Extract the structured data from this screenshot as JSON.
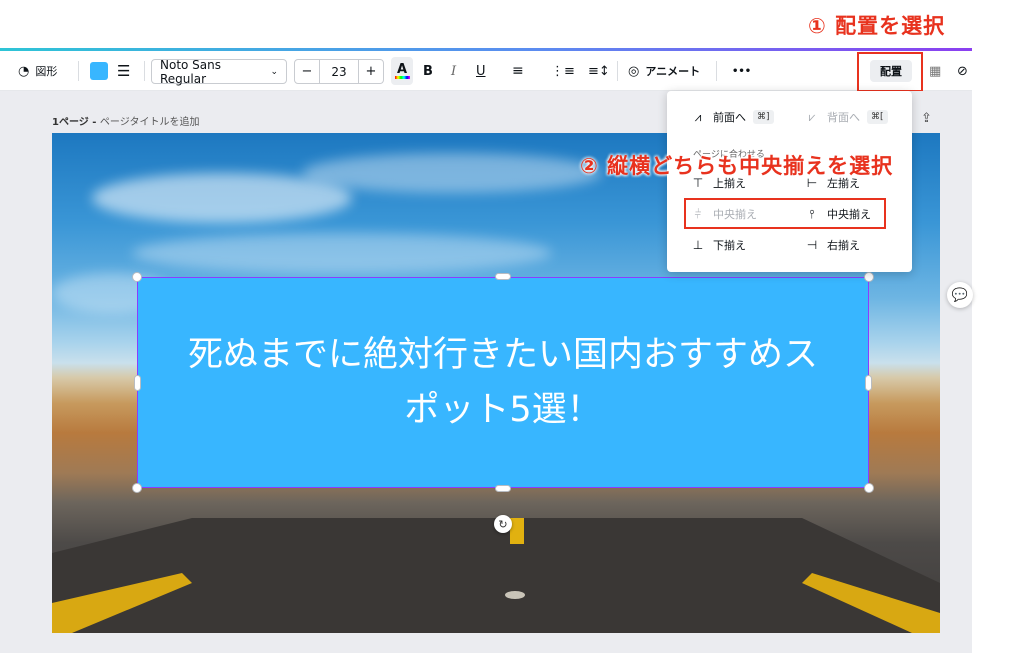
{
  "callouts": {
    "step1": "① 配置を選択",
    "step2": "② 縦横どちらも中央揃えを選択"
  },
  "toolbar": {
    "shape_label": "図形",
    "font_name": "Noto Sans Regular",
    "font_size": "23",
    "minus": "−",
    "plus": "+",
    "bold": "B",
    "italic": "I",
    "underline": "U",
    "animate_label": "アニメート",
    "more": "•••",
    "arrange_label": "配置",
    "fill_color": "#38b6ff"
  },
  "page": {
    "number_label": "1ページ",
    "separator": " - ",
    "title_placeholder": "ページタイトルを追加"
  },
  "textbox": {
    "headline": "死ぬまでに絶対行きたい国内おすすめスポット5選！",
    "bg_color": "#38b6ff",
    "selection_color": "#8b3dff"
  },
  "menu": {
    "forward": "前面へ",
    "forward_shortcut": "⌘]",
    "backward": "背面へ",
    "backward_shortcut": "⌘[",
    "section_title": "ページに合わせる",
    "align_top": "上揃え",
    "align_left": "左揃え",
    "align_middle": "中央揃え",
    "align_center": "中央揃え",
    "align_bottom": "下揃え",
    "align_right": "右揃え"
  },
  "colors": {
    "accent_red": "#e8321e",
    "canva_purple": "#8b3dff"
  }
}
